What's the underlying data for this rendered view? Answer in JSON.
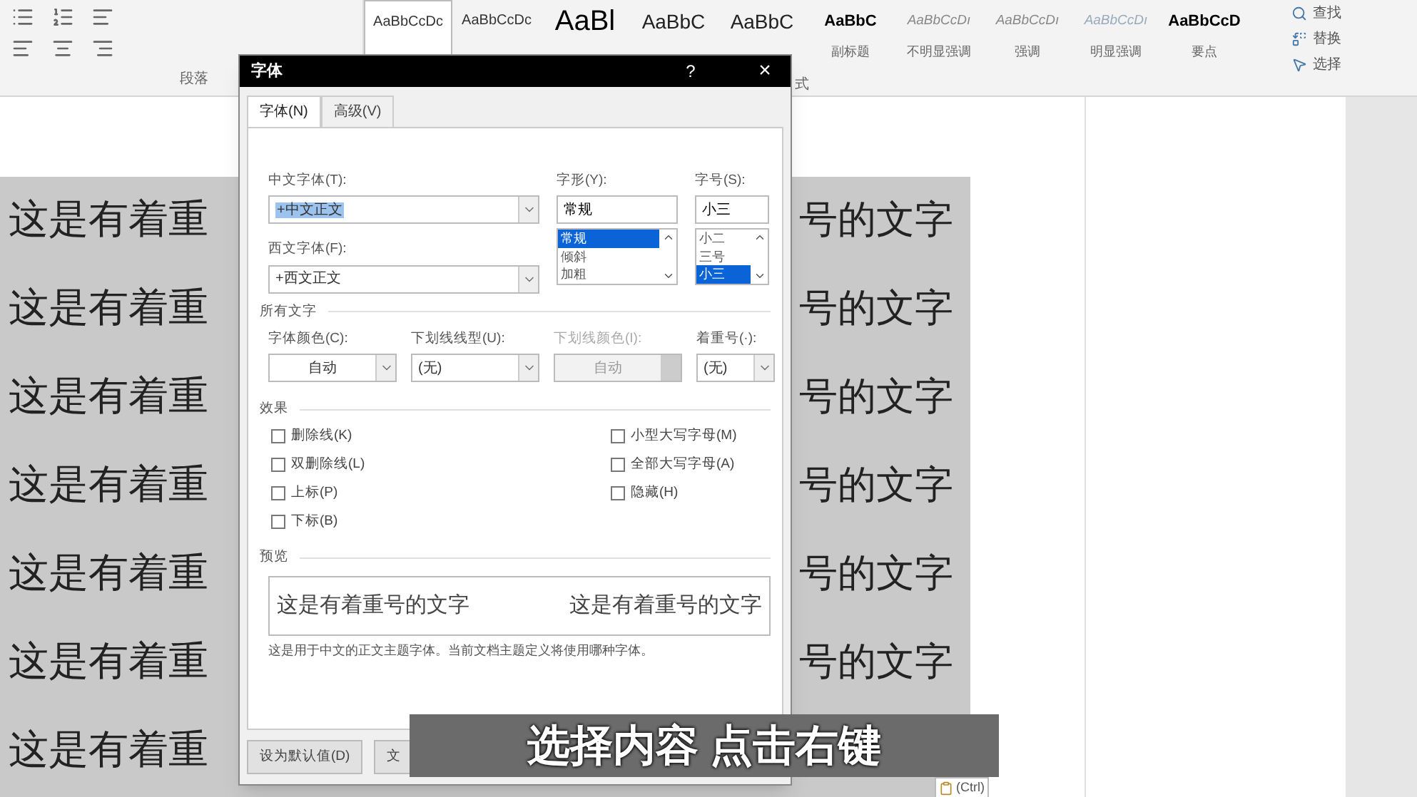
{
  "ribbon": {
    "groups": [
      {
        "label": "段落"
      },
      {
        "label": "式"
      }
    ],
    "styles": [
      {
        "preview": "AaBbCcDc",
        "kind": "plain"
      },
      {
        "preview": "AaBbCcDc",
        "kind": "plain"
      },
      {
        "preview": "AaBl",
        "kind": "big"
      },
      {
        "preview": "AaBbC",
        "kind": "heading"
      },
      {
        "preview": "AaBbC",
        "kind": "heading"
      },
      {
        "preview": "AaBbC",
        "kind": "bold",
        "label": "副标题"
      },
      {
        "preview": "AaBbCcDı",
        "kind": "italic",
        "label": "不明显强调"
      },
      {
        "preview": "AaBbCcDı",
        "kind": "italic",
        "label": "强调"
      },
      {
        "preview": "AaBbCcDı",
        "kind": "faint",
        "label": "明显强调"
      },
      {
        "preview": "AaBbCcD",
        "kind": "bold",
        "label": "要点"
      }
    ],
    "editing": [
      {
        "label": "查找",
        "kind": "search"
      },
      {
        "label": "替换",
        "kind": "replace"
      },
      {
        "label": "选择",
        "kind": "select"
      }
    ]
  },
  "document": {
    "lines": [
      {
        "left": "这是有着重",
        "right": "号的文字"
      },
      {
        "left": "这是有着重",
        "right": "号的文字"
      },
      {
        "left": "这是有着重",
        "right": "号的文字"
      },
      {
        "left": "这是有着重",
        "right": "号的文字"
      },
      {
        "left": "这是有着重",
        "right": "号的文字"
      },
      {
        "left": "这是有着重",
        "right": "号的文字"
      },
      {
        "left": "这是有着重"
      }
    ],
    "paste_options": "(Ctrl)"
  },
  "dialog": {
    "title": "字体",
    "help": "?",
    "close": "×",
    "tabs": [
      {
        "label": "字体(N)",
        "selected": true
      },
      {
        "label": "高级(V)",
        "selected": false
      }
    ],
    "chinese_font": {
      "label": "中文字体(T):",
      "value": "+中文正文"
    },
    "western_font": {
      "label": "西文字体(F):",
      "value": "+西文正文"
    },
    "style": {
      "label": "字形(Y):",
      "value": "常规",
      "options": [
        {
          "label": "常规",
          "selected": true
        },
        {
          "label": "倾斜",
          "selected": false
        },
        {
          "label": "加粗",
          "selected": false
        }
      ]
    },
    "size": {
      "label": "字号(S):",
      "value": "小三",
      "options": [
        {
          "label": "小二",
          "selected": false
        },
        {
          "label": "三号",
          "selected": false
        },
        {
          "label": "小三",
          "selected": true
        }
      ]
    },
    "all_text": {
      "heading": "所有文字",
      "fields": [
        {
          "label": "字体颜色(C):",
          "value": "自动",
          "disabled": false,
          "centered": true
        },
        {
          "label": "下划线线型(U):",
          "value": "(无)",
          "disabled": false,
          "centered": false
        },
        {
          "label": "下划线颜色(I):",
          "value": "自动",
          "disabled": true,
          "centered": true
        },
        {
          "label": "着重号(·):",
          "value": "(无)",
          "disabled": false,
          "centered": false
        }
      ]
    },
    "effects": {
      "heading": "效果",
      "left": [
        {
          "label": "删除线(K)",
          "checked": false
        },
        {
          "label": "双删除线(L)",
          "checked": false
        },
        {
          "label": "上标(P)",
          "checked": false
        },
        {
          "label": "下标(B)",
          "checked": false
        }
      ],
      "right": [
        {
          "label": "小型大写字母(M)",
          "checked": false
        },
        {
          "label": "全部大写字母(A)",
          "checked": false
        },
        {
          "label": "隐藏(H)",
          "checked": false
        }
      ]
    },
    "preview": {
      "heading": "预览",
      "samples": [
        "这是有着重号的文字",
        "这是有着重号的文字"
      ],
      "note": "这是用于中文的正文主题字体。当前文档主题定义将使用哪种字体。"
    },
    "buttons": [
      "设为默认值(D)",
      "文"
    ]
  },
  "caption": "选择内容 点击右键"
}
